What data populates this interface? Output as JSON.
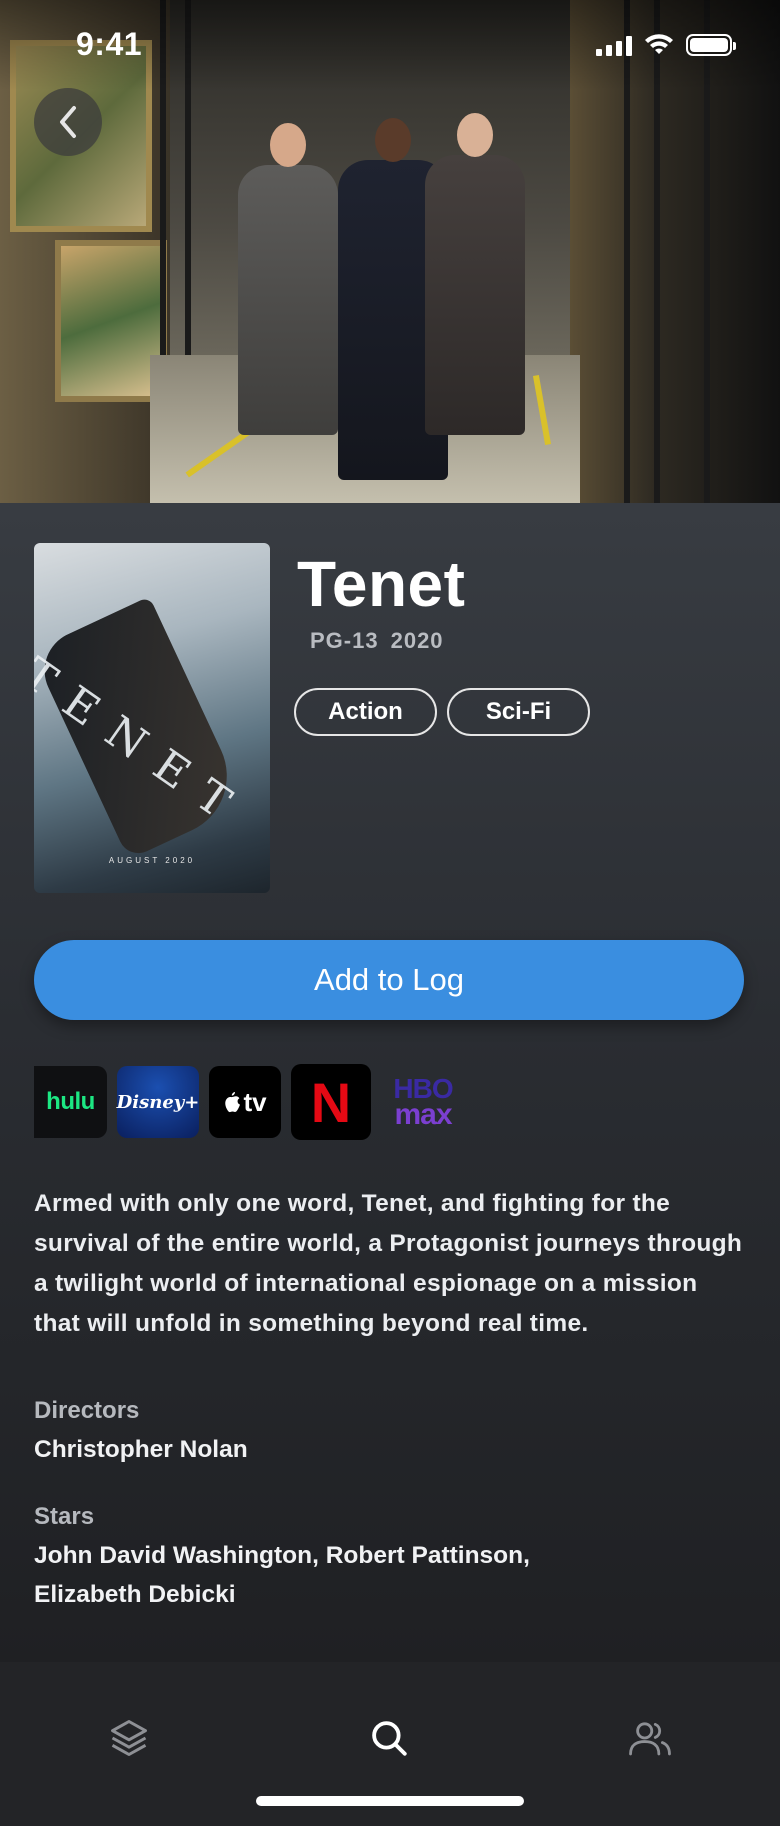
{
  "status_bar": {
    "time": "9:41"
  },
  "movie": {
    "title": "Tenet",
    "rating": "PG-13",
    "year": "2020",
    "genres": [
      "Action",
      "Sci-Fi"
    ],
    "description": "Armed with only one word, Tenet, and fighting for the survival of the entire world, a Protagonist journeys through a twilight world of international espionage on a mission that will unfold in something beyond real time.",
    "directors_label": "Directors",
    "directors": "Christopher Nolan",
    "stars_label": "Stars",
    "stars": "John David Washington, Robert Pattinson, Elizabeth Debicki"
  },
  "poster": {
    "word": "TENET",
    "date": "AUGUST 2020"
  },
  "actions": {
    "add_to_log": "Add to Log"
  },
  "streaming_services": [
    {
      "name": "hulu",
      "label": "hulu"
    },
    {
      "name": "disney-plus",
      "label": "Disney+"
    },
    {
      "name": "apple-tv",
      "label": "tv"
    },
    {
      "name": "netflix",
      "label": "N"
    },
    {
      "name": "hbo-max",
      "label_top": "HBO",
      "label_bottom": "max"
    }
  ],
  "tab_bar": {
    "tabs": [
      {
        "name": "log",
        "icon": "layers-icon"
      },
      {
        "name": "search",
        "icon": "search-icon",
        "active": true
      },
      {
        "name": "friends",
        "icon": "users-icon"
      }
    ]
  },
  "colors": {
    "accent": "#3a8ee0",
    "background": "#1c1d20",
    "hulu": "#1ce783",
    "netflix": "#e50914"
  }
}
